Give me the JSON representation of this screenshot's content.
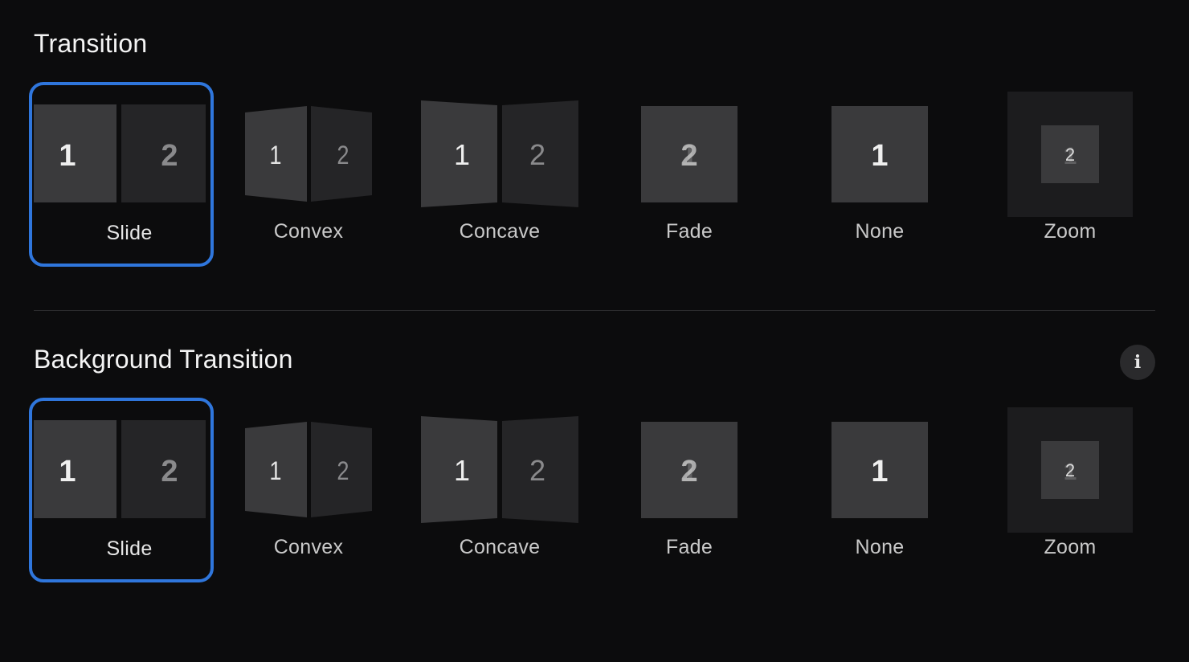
{
  "transition": {
    "title": "Transition",
    "selected": "Slide",
    "options": [
      {
        "label": "Slide",
        "page1": "1",
        "page2": "2"
      },
      {
        "label": "Convex",
        "page1": "1",
        "page2": "2"
      },
      {
        "label": "Concave",
        "page1": "1",
        "page2": "2"
      },
      {
        "label": "Fade",
        "page1": "1",
        "page2": "2"
      },
      {
        "label": "None",
        "page1": "1"
      },
      {
        "label": "Zoom",
        "page1": "1",
        "page2": "2"
      }
    ]
  },
  "background_transition": {
    "title": "Background Transition",
    "info_icon": "info-icon",
    "info_glyph": "i",
    "selected": "Slide",
    "options": [
      {
        "label": "Slide",
        "page1": "1",
        "page2": "2"
      },
      {
        "label": "Convex",
        "page1": "1",
        "page2": "2"
      },
      {
        "label": "Concave",
        "page1": "1",
        "page2": "2"
      },
      {
        "label": "Fade",
        "page1": "1",
        "page2": "2"
      },
      {
        "label": "None",
        "page1": "1"
      },
      {
        "label": "Zoom",
        "page1": "1",
        "page2": "2"
      }
    ]
  },
  "colors": {
    "background": "#0c0c0d",
    "selection_accent": "#2f76dc",
    "page_light": "#3a3a3c",
    "page_dark": "#252527"
  }
}
